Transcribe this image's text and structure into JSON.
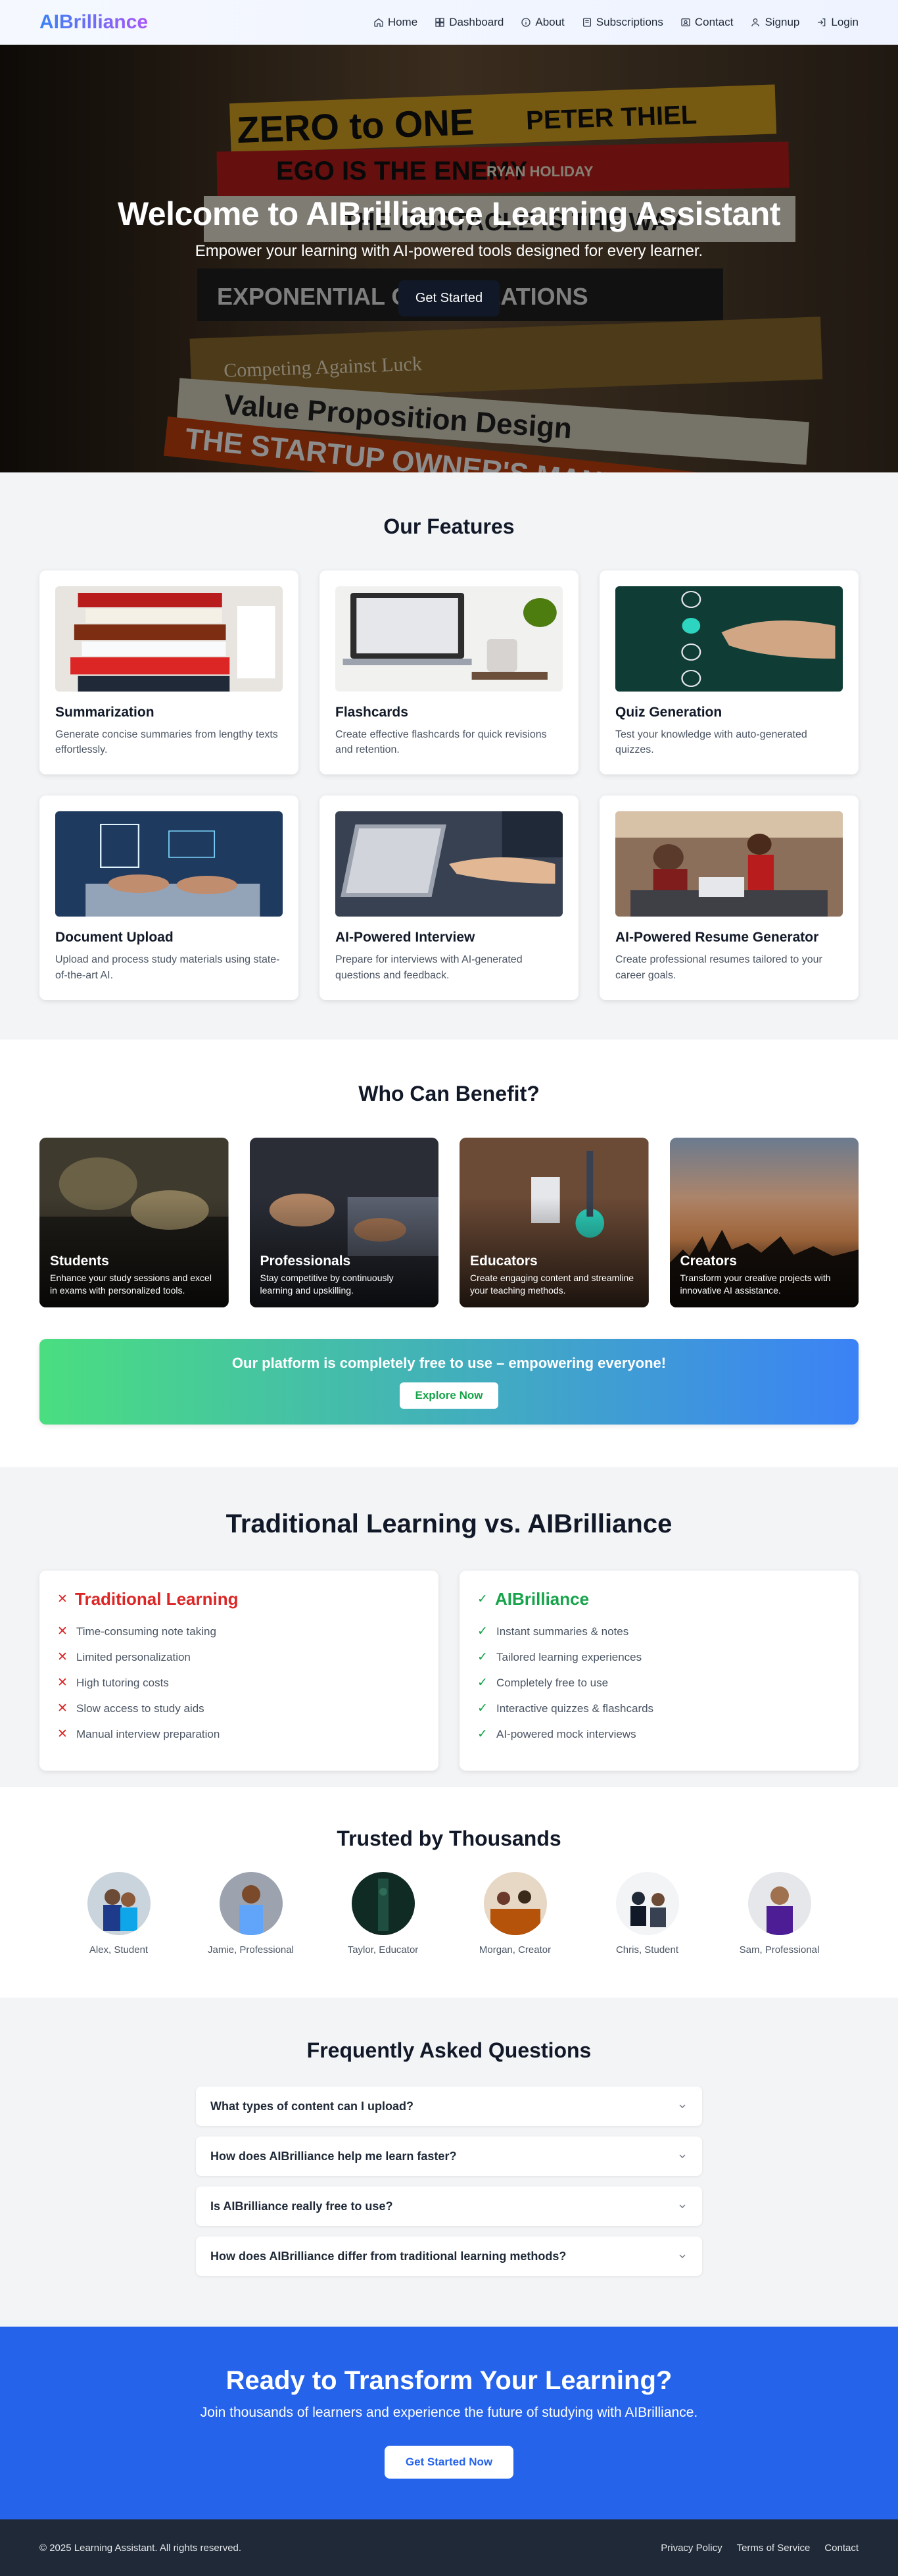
{
  "nav": {
    "brand": "AIBrilliance",
    "links": [
      {
        "label": "Home",
        "icon": "home-icon"
      },
      {
        "label": "Dashboard",
        "icon": "grid-icon"
      },
      {
        "label": "About",
        "icon": "info-icon"
      },
      {
        "label": "Subscriptions",
        "icon": "card-icon"
      },
      {
        "label": "Contact",
        "icon": "contact-icon"
      },
      {
        "label": "Signup",
        "icon": "user-icon"
      },
      {
        "label": "Login",
        "icon": "login-icon"
      }
    ]
  },
  "hero": {
    "title": "Welcome to AIBrilliance Learning Assistant",
    "subtitle": "Empower your learning with AI-powered tools designed for every learner.",
    "button": "Get Started",
    "book_titles": [
      "ZERO to ONE",
      "PETER THIEL",
      "EGO IS THE ENEMY",
      "RYAN HOLIDAY",
      "THE OBSTACLE IS THE WAY",
      "EXPONENTIAL ORGANIZATIONS",
      "Competing Against Luck",
      "Value Proposition Design",
      "THE STARTUP OWNER'S MANUAL"
    ]
  },
  "features": {
    "title": "Our Features",
    "items": [
      {
        "title": "Summarization",
        "desc": "Generate concise summaries from lengthy texts effortlessly."
      },
      {
        "title": "Flashcards",
        "desc": "Create effective flashcards for quick revisions and retention."
      },
      {
        "title": "Quiz Generation",
        "desc": "Test your knowledge with auto-generated quizzes."
      },
      {
        "title": "Document Upload",
        "desc": "Upload and process study materials using state-of-the-art AI."
      },
      {
        "title": "AI-Powered Interview",
        "desc": "Prepare for interviews with AI-generated questions and feedback."
      },
      {
        "title": "AI-Powered Resume Generator",
        "desc": "Create professional resumes tailored to your career goals."
      }
    ]
  },
  "benefit": {
    "title": "Who Can Benefit?",
    "items": [
      {
        "title": "Students",
        "desc": "Enhance your study sessions and excel in exams with personalized tools."
      },
      {
        "title": "Professionals",
        "desc": "Stay competitive by continuously learning and upskilling."
      },
      {
        "title": "Educators",
        "desc": "Create engaging content and streamline your teaching methods."
      },
      {
        "title": "Creators",
        "desc": "Transform your creative projects with innovative AI assistance."
      }
    ],
    "banner_text": "Our platform is completely free to use – empowering everyone!",
    "banner_button": "Explore Now"
  },
  "compare": {
    "title": "Traditional Learning vs. AIBrilliance",
    "traditional": {
      "title": "Traditional Learning",
      "items": [
        "Time-consuming note taking",
        "Limited personalization",
        "High tutoring costs",
        "Slow access to study aids",
        "Manual interview preparation"
      ]
    },
    "ai": {
      "title": "AIBrilliance",
      "items": [
        "Instant summaries & notes",
        "Tailored learning experiences",
        "Completely free to use",
        "Interactive quizzes & flashcards",
        "AI-powered mock interviews"
      ]
    },
    "colors": {
      "negative": "#dc2626",
      "positive": "#16a34a"
    }
  },
  "trusted": {
    "title": "Trusted by Thousands",
    "people": [
      "Alex, Student",
      "Jamie, Professional",
      "Taylor, Educator",
      "Morgan, Creator",
      "Chris, Student",
      "Sam, Professional"
    ]
  },
  "faq": {
    "title": "Frequently Asked Questions",
    "items": [
      "What types of content can I upload?",
      "How does AIBrilliance help me learn faster?",
      "Is AIBrilliance really free to use?",
      "How does AIBrilliance differ from traditional learning methods?"
    ]
  },
  "cta": {
    "title": "Ready to Transform Your Learning?",
    "subtitle": "Join thousands of learners and experience the future of studying with AIBrilliance.",
    "button": "Get Started Now"
  },
  "footer": {
    "copyright": "© 2025 Learning Assistant. All rights reserved.",
    "links": [
      "Privacy Policy",
      "Terms of Service",
      "Contact"
    ]
  },
  "theme": {
    "accent": "#2563eb",
    "dark": "#1f2937"
  }
}
